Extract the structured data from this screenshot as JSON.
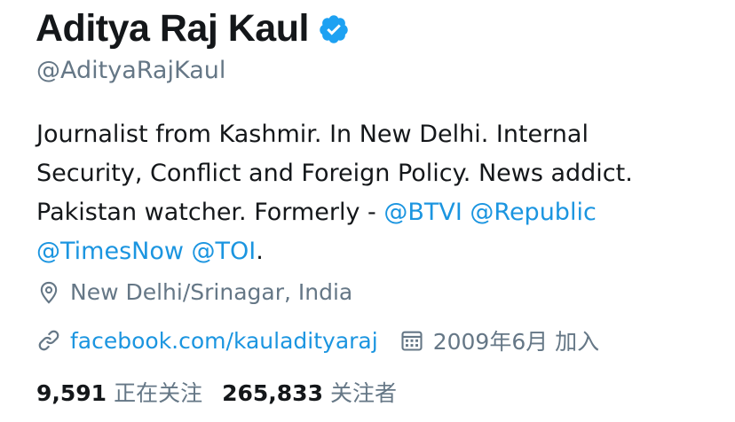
{
  "profile": {
    "display_name": "Aditya Raj Kaul",
    "handle": "@AdityaRajKaul",
    "verified_icon": "verified-badge-icon",
    "bio": {
      "line1": "Journalist from Kashmir. In New Delhi. Internal",
      "line2": "Security, Conflict and Foreign Policy. News addict.",
      "line3_prefix": "Pakistan watcher. Formerly - ",
      "mentions": [
        "@BTVI",
        "@Republic",
        "@TimesNow",
        "@TOI"
      ],
      "suffix": "."
    },
    "location": {
      "icon": "location-pin-icon",
      "text": "New Delhi/Srinagar, India"
    },
    "website": {
      "icon": "link-icon",
      "text": "facebook.com/kauladityaraj"
    },
    "joined": {
      "icon": "calendar-icon",
      "text": "2009年6月 加入"
    },
    "stats": {
      "following_count": "9,591",
      "following_label": "正在关注",
      "followers_count": "265,833",
      "followers_label": "关注者"
    }
  },
  "colors": {
    "text": "#14171a",
    "secondary": "#657786",
    "link": "#1b95e0",
    "verified": "#1da1f2"
  }
}
